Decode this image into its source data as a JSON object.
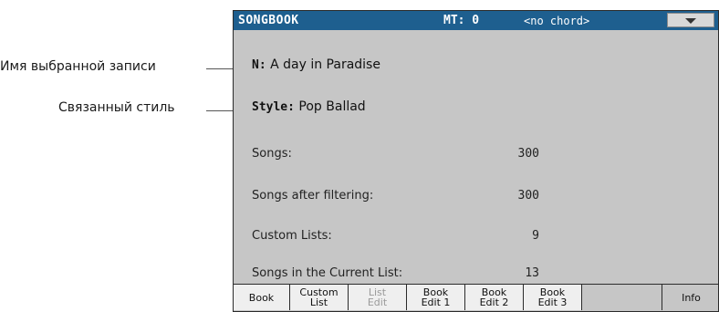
{
  "callouts": {
    "selected_entry": "Имя выбранной записи",
    "linked_style": "Связанный стиль"
  },
  "header": {
    "title": "SONGBOOK",
    "mt": "MT: 0",
    "chord": "<no chord>",
    "menu_icon": "chevron-down-icon"
  },
  "entry": {
    "name_label": "N:",
    "name_value": "A day in Paradise",
    "style_label": "Style:",
    "style_value": "Pop Ballad"
  },
  "stats": [
    {
      "label": "Songs:",
      "value": "300"
    },
    {
      "label": "Songs after filtering:",
      "value": "300"
    },
    {
      "label": "Custom Lists:",
      "value": "9"
    },
    {
      "label": "Songs in the Current List:",
      "value": "13"
    }
  ],
  "tabs": [
    {
      "label": "Book",
      "disabled": false
    },
    {
      "label": "Custom\nList",
      "disabled": false
    },
    {
      "label": "List\nEdit",
      "disabled": true
    },
    {
      "label": "Book\nEdit 1",
      "disabled": false
    },
    {
      "label": "Book\nEdit 2",
      "disabled": false
    },
    {
      "label": "Book\nEdit 3",
      "disabled": false
    },
    {
      "label": "Info",
      "disabled": false
    }
  ],
  "colors": {
    "header_bg": "#1e5f8f",
    "screen_bg": "#c6c6c6"
  }
}
